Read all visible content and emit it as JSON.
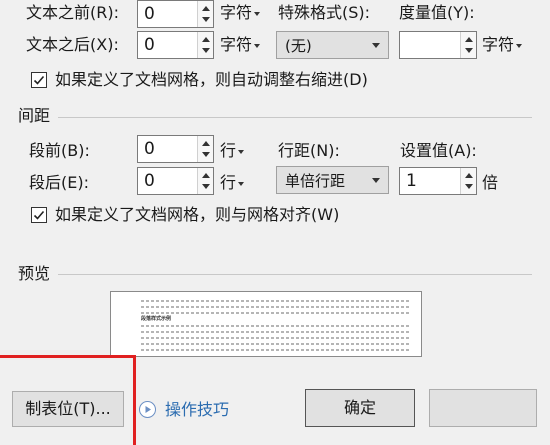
{
  "indent": {
    "before_label": "文本之前(R):",
    "before_value": "0",
    "before_unit": "字符",
    "after_label": "文本之后(X):",
    "after_value": "0",
    "after_unit": "字符",
    "special_label": "特殊格式(S):",
    "special_value": "(无)",
    "measure_label": "度量值(Y):",
    "measure_value": "",
    "measure_unit": "字符",
    "grid_checkbox_label": "如果定义了文档网格，则自动调整右缩进(D)",
    "grid_checked": true
  },
  "spacing": {
    "section_title": "间距",
    "before_label": "段前(B):",
    "before_value": "0",
    "before_unit": "行",
    "after_label": "段后(E):",
    "after_value": "0",
    "after_unit": "行",
    "line_label": "行距(N):",
    "line_value": "单倍行距",
    "setting_label": "设置值(A):",
    "setting_value": "1",
    "setting_unit": "倍",
    "grid_checkbox_label": "如果定义了文档网格，则与网格对齐(W)",
    "grid_checked": true
  },
  "preview": {
    "section_title": "预览",
    "sample_text": "段落样式示例"
  },
  "footer": {
    "tabs_button": "制表位(T)...",
    "tips_link": "操作技巧",
    "ok_button": "确定",
    "cancel_button": ""
  },
  "colors": {
    "highlight": "#e02020",
    "link": "#2b6cb0"
  }
}
